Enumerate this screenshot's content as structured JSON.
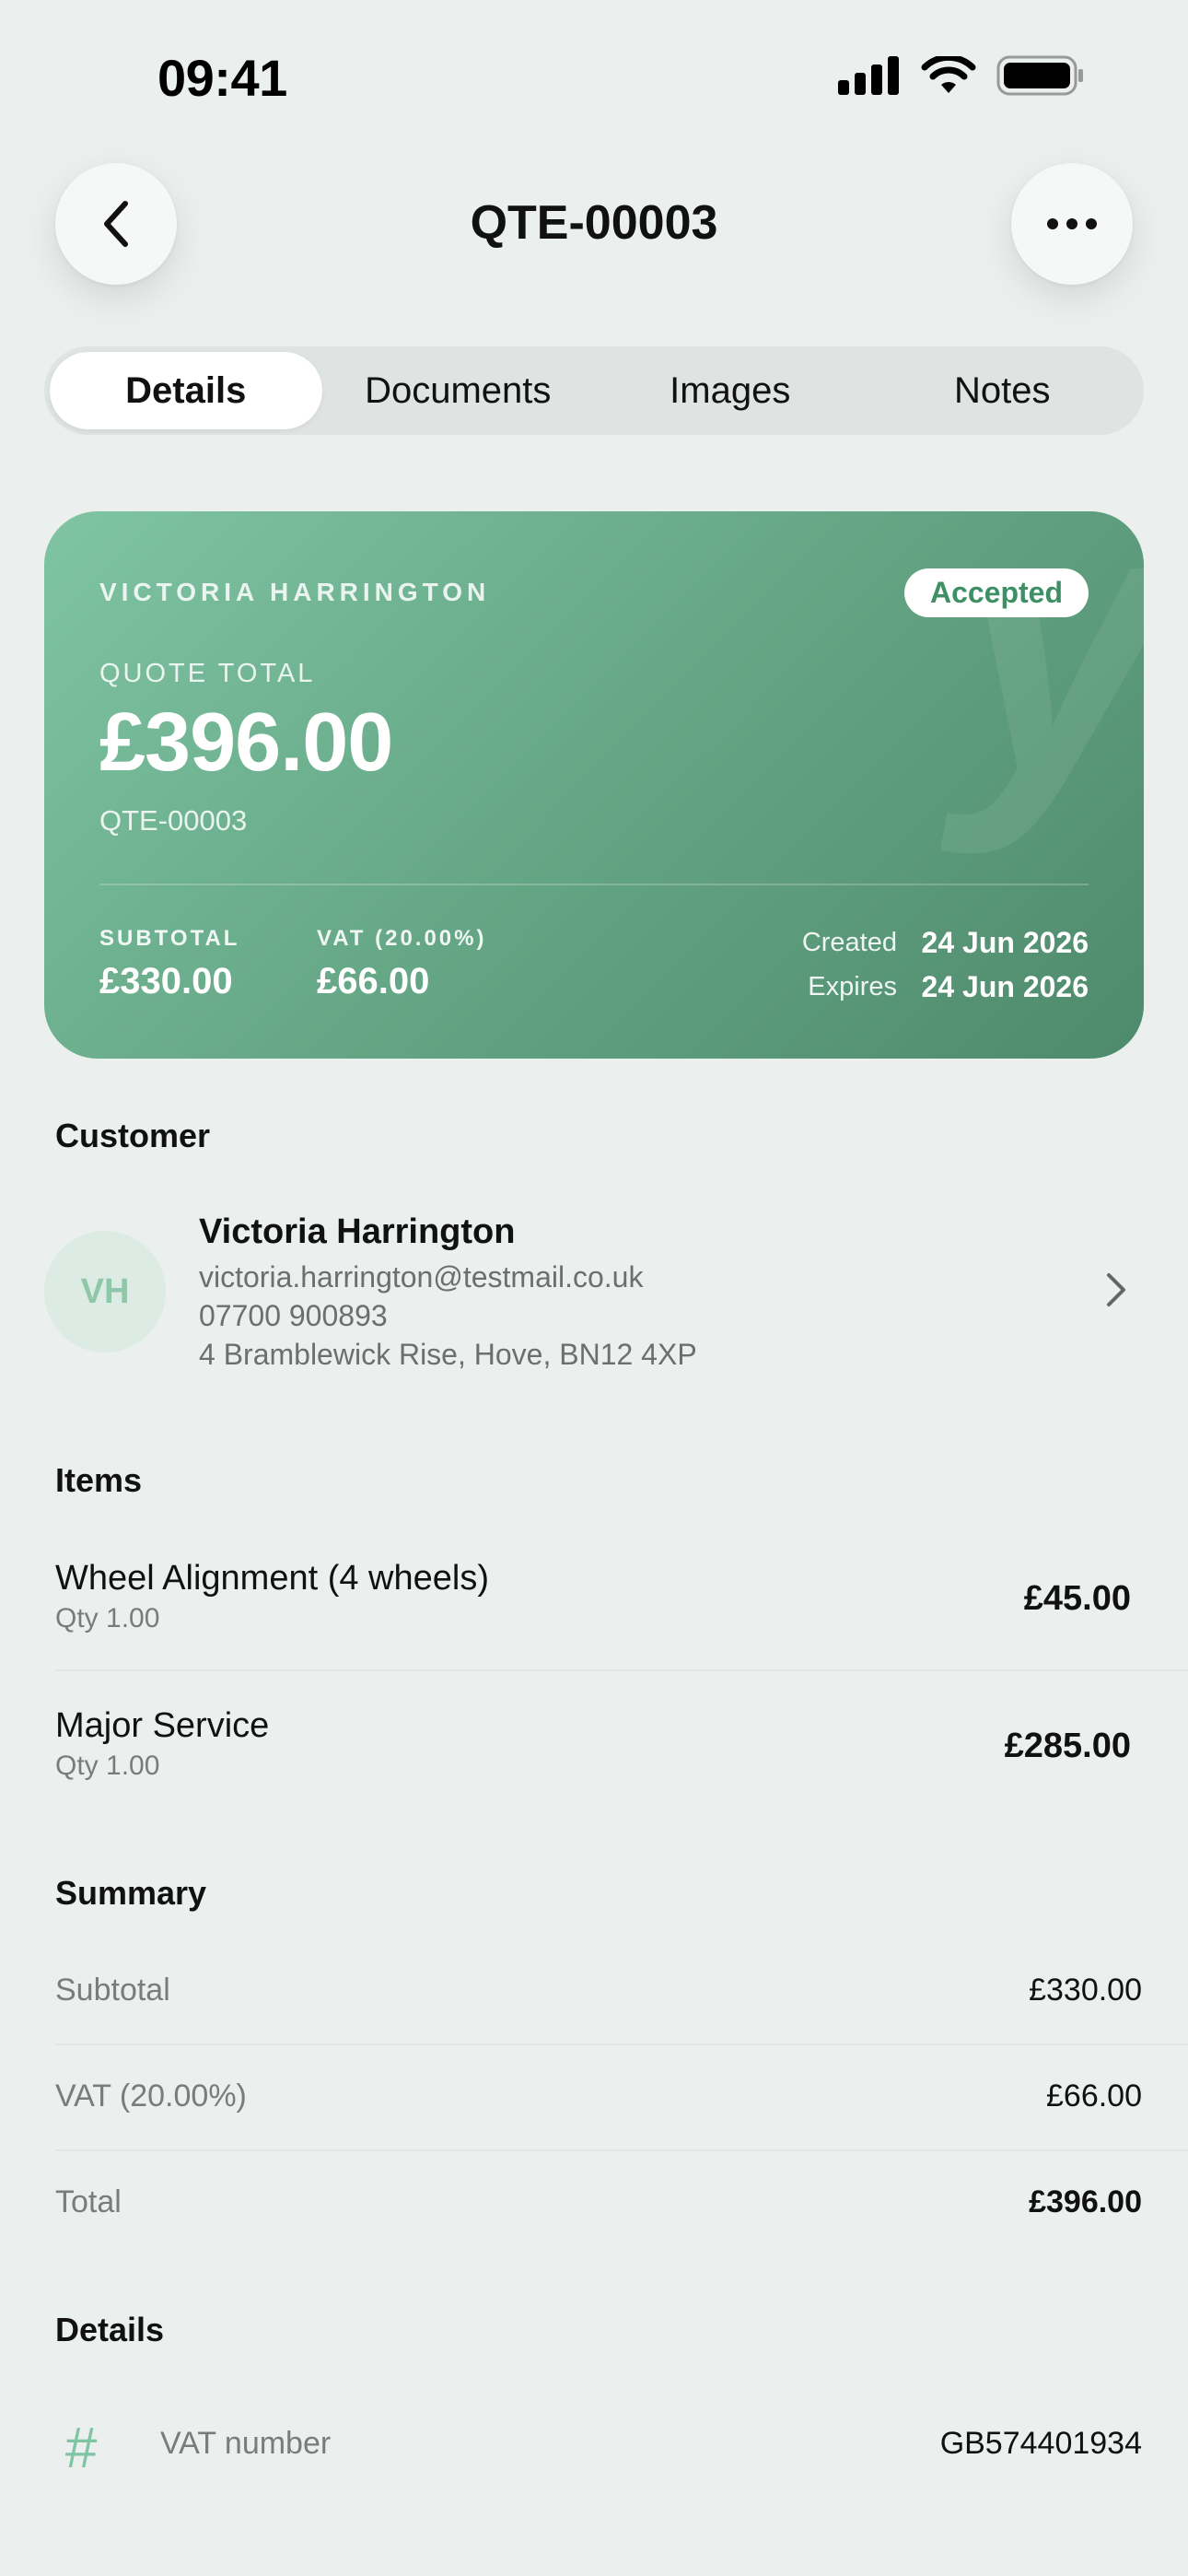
{
  "status_bar": {
    "time": "09:41",
    "icons": [
      "signal-icon",
      "wifi-icon",
      "battery-icon"
    ]
  },
  "nav": {
    "title": "QTE-00003",
    "back_icon": "chevron-left-icon",
    "more_icon": "ellipsis-icon"
  },
  "tabs": [
    {
      "label": "Details",
      "active": true
    },
    {
      "label": "Documents",
      "active": false
    },
    {
      "label": "Images",
      "active": false
    },
    {
      "label": "Notes",
      "active": false
    }
  ],
  "quote_card": {
    "customer_name": "VICTORIA HARRINGTON",
    "status": "Accepted",
    "total_label": "QUOTE TOTAL",
    "total": "£396.00",
    "reference": "QTE-00003",
    "subtotal_label": "SUBTOTAL",
    "subtotal": "£330.00",
    "vat_label": "VAT (20.00%)",
    "vat": "£66.00",
    "created_label": "Created",
    "created": "24 Jun 2026",
    "expires_label": "Expires",
    "expires": "24 Jun 2026",
    "colors": {
      "gradient_start": "#7fc4a3",
      "gradient_end": "#4e8a6c",
      "status_text": "#3f8f66"
    }
  },
  "customer": {
    "section_title": "Customer",
    "initials": "VH",
    "name": "Victoria Harrington",
    "email": "victoria.harrington@testmail.co.uk",
    "phone": "07700 900893",
    "address": "4 Bramblewick Rise, Hove, BN12 4XP"
  },
  "items": {
    "section_title": "Items",
    "rows": [
      {
        "name": "Wheel Alignment (4 wheels)",
        "qty": "Qty 1.00",
        "price": "£45.00"
      },
      {
        "name": "Major Service",
        "qty": "Qty 1.00",
        "price": "£285.00"
      }
    ]
  },
  "summary": {
    "section_title": "Summary",
    "rows": [
      {
        "label": "Subtotal",
        "value": "£330.00"
      },
      {
        "label": "VAT (20.00%)",
        "value": "£66.00"
      },
      {
        "label": "Total",
        "value": "£396.00"
      }
    ]
  },
  "details": {
    "section_title": "Details",
    "rows": [
      {
        "icon": "hash-icon",
        "label": "VAT number",
        "value": "GB574401934"
      }
    ]
  }
}
